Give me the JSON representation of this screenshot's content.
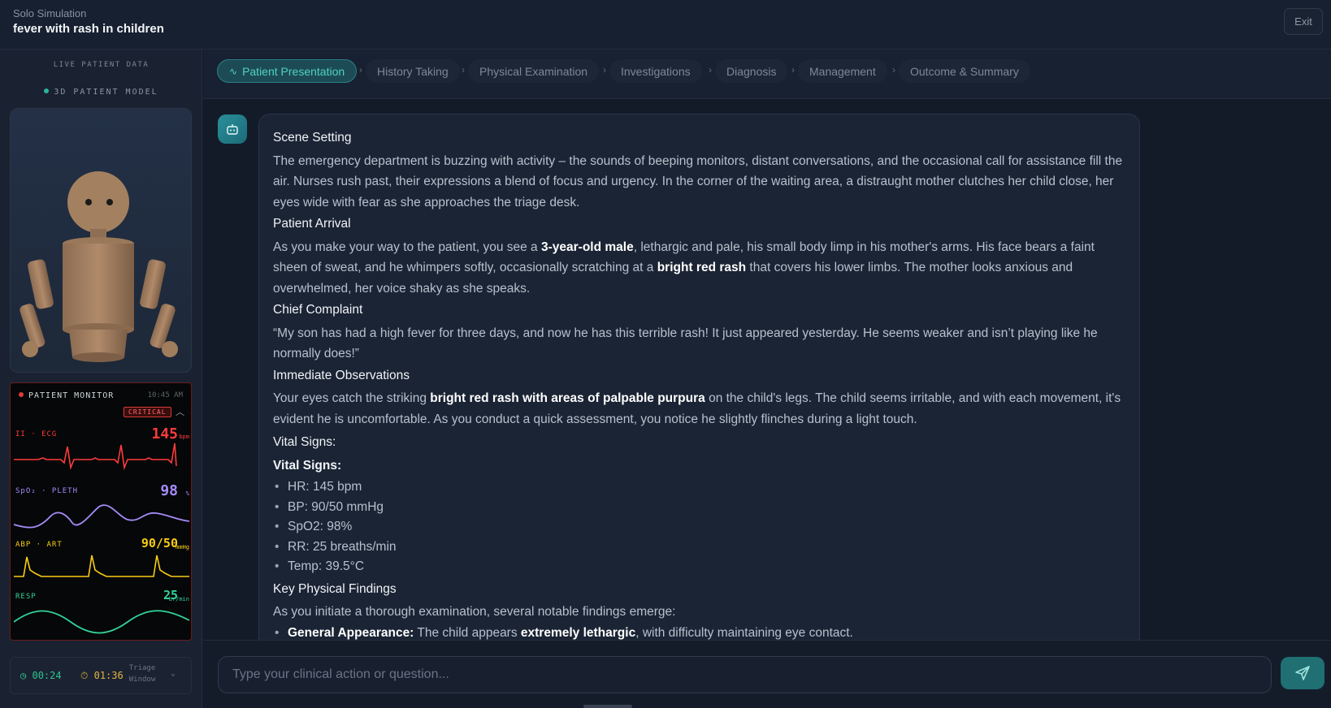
{
  "header": {
    "subtitle": "Solo Simulation",
    "title": "fever with rash in children",
    "exit_label": "Exit"
  },
  "sidebar": {
    "live_label": "LIVE PATIENT DATA",
    "model_label": "3D PATIENT MODEL",
    "monitor": {
      "title": "PATIENT MONITOR",
      "time": "10:45 AM",
      "status": "CRITICAL",
      "channels": [
        {
          "label": "II · ECG",
          "value": "145",
          "unit": "bpm",
          "color": "#ff3b3b"
        },
        {
          "label": "SpO₂ · PLETH",
          "value": "98",
          "unit": "%",
          "color": "#a78bfa"
        },
        {
          "label": "ABP · ART",
          "value": "90/50",
          "unit": "mmHg",
          "color": "#facc15"
        },
        {
          "label": "RESP",
          "value": "25",
          "unit": "br/min",
          "color": "#34d399"
        }
      ]
    },
    "timers": {
      "elapsed": "00:24",
      "countdown": "01:36",
      "window_label": "Triage Window"
    }
  },
  "steps": [
    {
      "label": "Patient Presentation",
      "active": true
    },
    {
      "label": "History Taking"
    },
    {
      "label": "Physical Examination"
    },
    {
      "label": "Investigations"
    },
    {
      "label": "Diagnosis"
    },
    {
      "label": "Management"
    },
    {
      "label": "Outcome & Summary"
    }
  ],
  "message": {
    "scene_heading": "Scene Setting",
    "scene_text": "The emergency department is buzzing with activity – the sounds of beeping monitors, distant conversations, and the occasional call for assistance fill the air. Nurses rush past, their expressions a blend of focus and urgency. In the corner of the waiting area, a distraught mother clutches her child close, her eyes wide with fear as she approaches the triage desk.",
    "arrival_heading": "Patient Arrival",
    "arrival_1": "As you make your way to the patient, you see a ",
    "arrival_b1": "3-year-old male",
    "arrival_2": ", lethargic and pale, his small body limp in his mother's arms. His face bears a faint sheen of sweat, and he whimpers softly, occasionally scratching at a ",
    "arrival_b2": "bright red rash",
    "arrival_3": " that covers his lower limbs. The mother looks anxious and overwhelmed, her voice shaky as she speaks.",
    "complaint_heading": "Chief Complaint",
    "complaint_text": "“My son has had a high fever for three days, and now he has this terrible rash! It just appeared yesterday. He seems weaker and isn’t playing like he normally does!”",
    "obs_heading": "Immediate Observations",
    "obs_1": "Your eyes catch the striking ",
    "obs_b1": "bright red rash with areas of palpable purpura",
    "obs_2": " on the child's legs. The child seems irritable, and with each movement, it's evident he is uncomfortable. As you conduct a quick assessment, you notice he slightly flinches during a light touch.",
    "vitals_heading": "Vital Signs:",
    "vitals_heading_bold": "Vital Signs:",
    "vitals": [
      "HR: 145 bpm",
      "BP: 90/50 mmHg",
      "SpO2: 98%",
      "RR: 25 breaths/min",
      "Temp: 39.5°C"
    ],
    "findings_heading": "Key Physical Findings",
    "findings_text": "As you initiate a thorough examination, several notable findings emerge:",
    "finding_1_label": "General Appearance:",
    "finding_1_text_a": " The child appears ",
    "finding_1_bold": "extremely lethargic",
    "finding_1_text_b": ", with difficulty maintaining eye contact."
  },
  "input": {
    "placeholder": "Type your clinical action or question..."
  }
}
